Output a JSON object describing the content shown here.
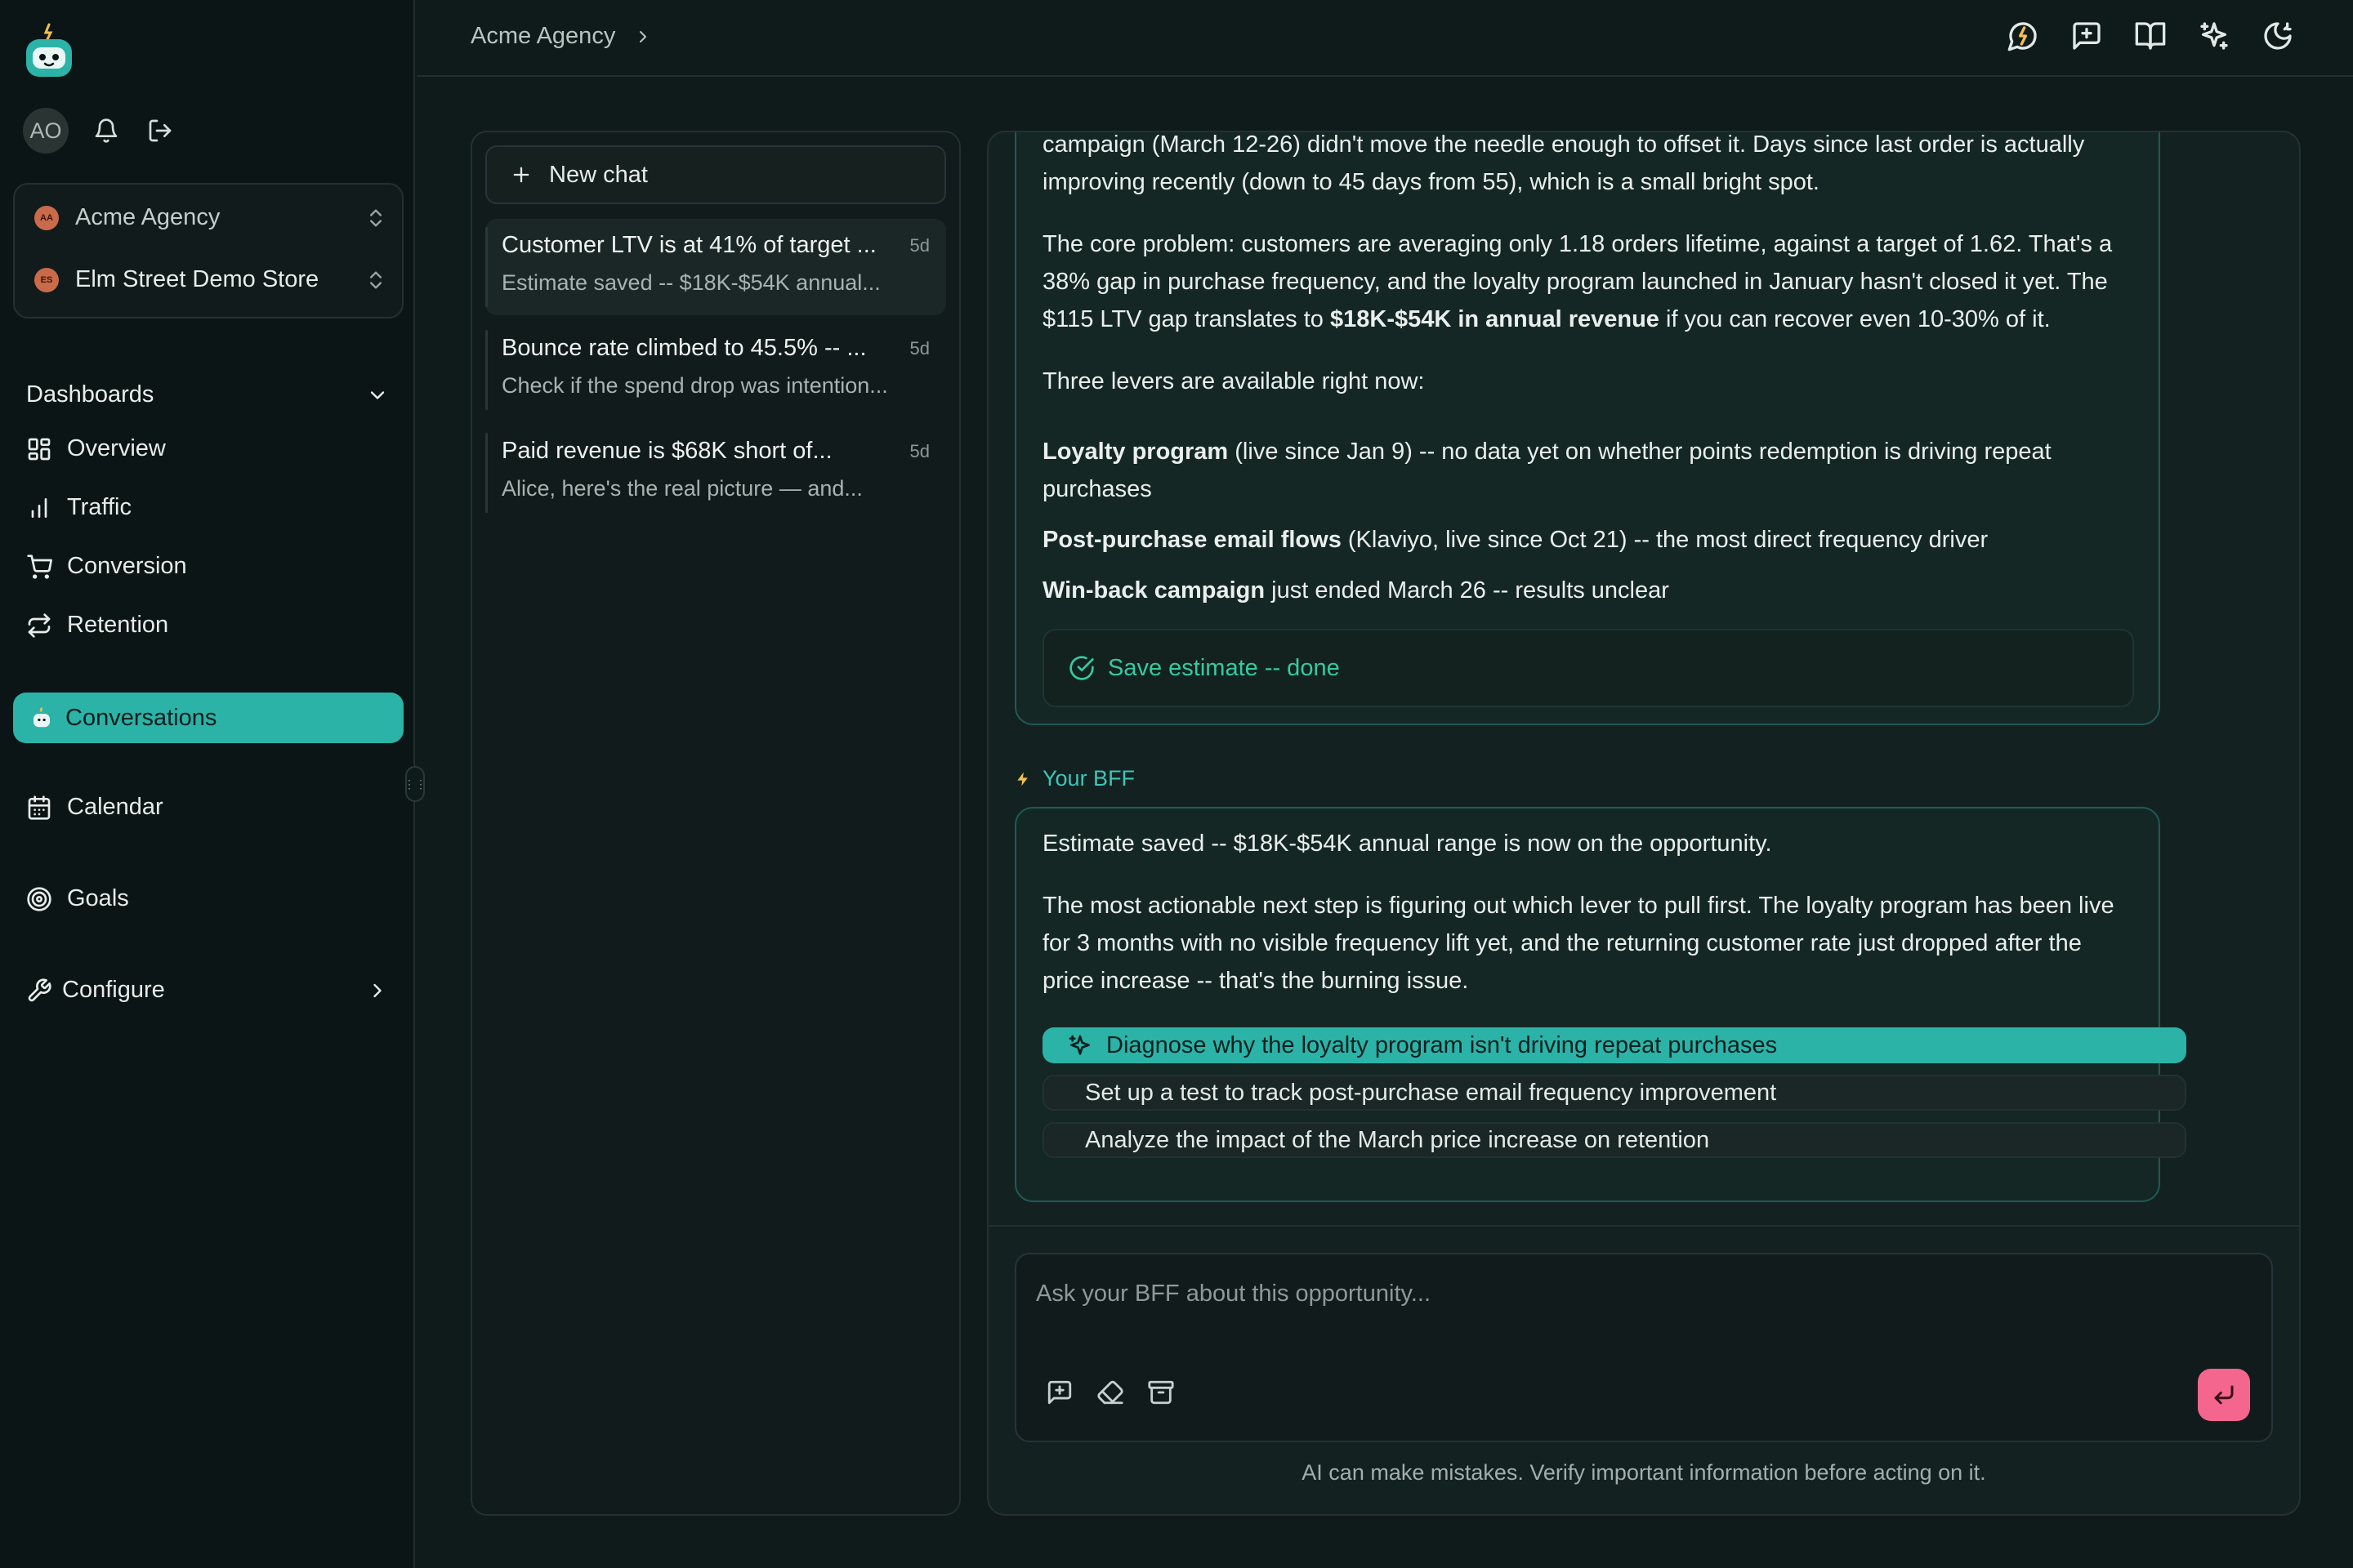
{
  "sidebar": {
    "user_initials": "AO",
    "agency": {
      "initials": "AA",
      "name": "Acme Agency"
    },
    "store": {
      "initials": "ES",
      "name": "Elm Street Demo Store"
    },
    "dashboards_label": "Dashboards",
    "items": [
      {
        "label": "Overview"
      },
      {
        "label": "Traffic"
      },
      {
        "label": "Conversion"
      },
      {
        "label": "Retention"
      }
    ],
    "conversations_label": "Conversations",
    "calendar_label": "Calendar",
    "goals_label": "Goals",
    "configure_label": "Configure"
  },
  "header": {
    "breadcrumb": "Acme Agency"
  },
  "chat_list": {
    "new_chat_label": "New chat",
    "items": [
      {
        "title": "Customer LTV is at 41% of target ...",
        "age": "5d",
        "snippet": "Estimate saved -- $18K-$54K annual..."
      },
      {
        "title": "Bounce rate climbed to 45.5% -- ...",
        "age": "5d",
        "snippet": "Check if the spend drop was intention..."
      },
      {
        "title": "Paid revenue is $68K short of...",
        "age": "5d",
        "snippet": "Alice, here's the real picture — and..."
      }
    ]
  },
  "thread": {
    "msg1": {
      "p1": "campaign (March 12-26) didn't move the needle enough to offset it. Days since last order is actually improving recently (down to 45 days from 55), which is a small bright spot.",
      "p2_a": "The core problem: customers are averaging only 1.18 orders lifetime, against a target of 1.62. That's a 38% gap in purchase frequency, and the loyalty program launched in January hasn't closed it yet. The $115 LTV gap translates to ",
      "p2_bold": "$18K-$54K in annual revenue",
      "p2_b": " if you can recover even 10-30% of it.",
      "p3": "Three levers are available right now:",
      "lever1_bold": "Loyalty program",
      "lever1_rest": " (live since Jan 9) -- no data yet on whether points redemption is driving repeat purchases",
      "lever2_bold": "Post-purchase email flows",
      "lever2_rest": " (Klaviyo, live since Oct 21) -- the most direct frequency driver",
      "lever3_bold": "Win-back campaign",
      "lever3_rest": " just ended March 26 -- results unclear",
      "tool_status": "Save estimate -- done"
    },
    "author": "Your BFF",
    "msg2": {
      "p1": "Estimate saved -- $18K-$54K annual range is now on the opportunity.",
      "p2": "The most actionable next step is figuring out which lever to pull first. The loyalty program has been live for 3 months with no visible frequency lift yet, and the returning customer rate just dropped after the price increase -- that's the burning issue.",
      "suggestions": [
        "Diagnose why the loyalty program isn't driving repeat purchases",
        "Set up a test to track post-purchase email frequency improvement",
        "Analyze the impact of the March price increase on retention"
      ]
    }
  },
  "composer": {
    "placeholder": "Ask your BFF about this opportunity...",
    "disclaimer": "AI can make mistakes. Verify important information before acting on it."
  },
  "colors": {
    "accent": "#2bb3a8",
    "send": "#f4668d",
    "success": "#37c9a0"
  }
}
